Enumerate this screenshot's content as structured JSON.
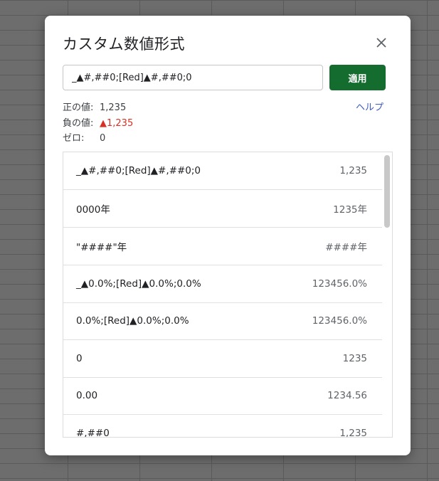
{
  "dialog": {
    "title": "カスタム数値形式",
    "close_icon": "close-icon",
    "input_value": "_▲#,##0;[Red]▲#,##0;0",
    "apply_label": "適用",
    "help_label": "ヘルプ",
    "accent_color": "#146c2e",
    "negative_color": "#d93025"
  },
  "preview": {
    "positive_label": "正の値:",
    "positive_value": "1,235",
    "negative_label": "負の値:",
    "negative_value": "▲1,235",
    "zero_label": "ゼロ:",
    "zero_value": "0"
  },
  "formats": [
    {
      "code": "_▲#,##0;[Red]▲#,##0;0",
      "sample": "1,235"
    },
    {
      "code": "0000年",
      "sample": "1235年"
    },
    {
      "code": "\"####\"年",
      "sample": "####年"
    },
    {
      "code": "_▲0.0%;[Red]▲0.0%;0.0%",
      "sample": "123456.0%"
    },
    {
      "code": "0.0%;[Red]▲0.0%;0.0%",
      "sample": "123456.0%"
    },
    {
      "code": "0",
      "sample": "1235"
    },
    {
      "code": "0.00",
      "sample": "1234.56"
    },
    {
      "code": "#,##0",
      "sample": "1,235"
    }
  ]
}
